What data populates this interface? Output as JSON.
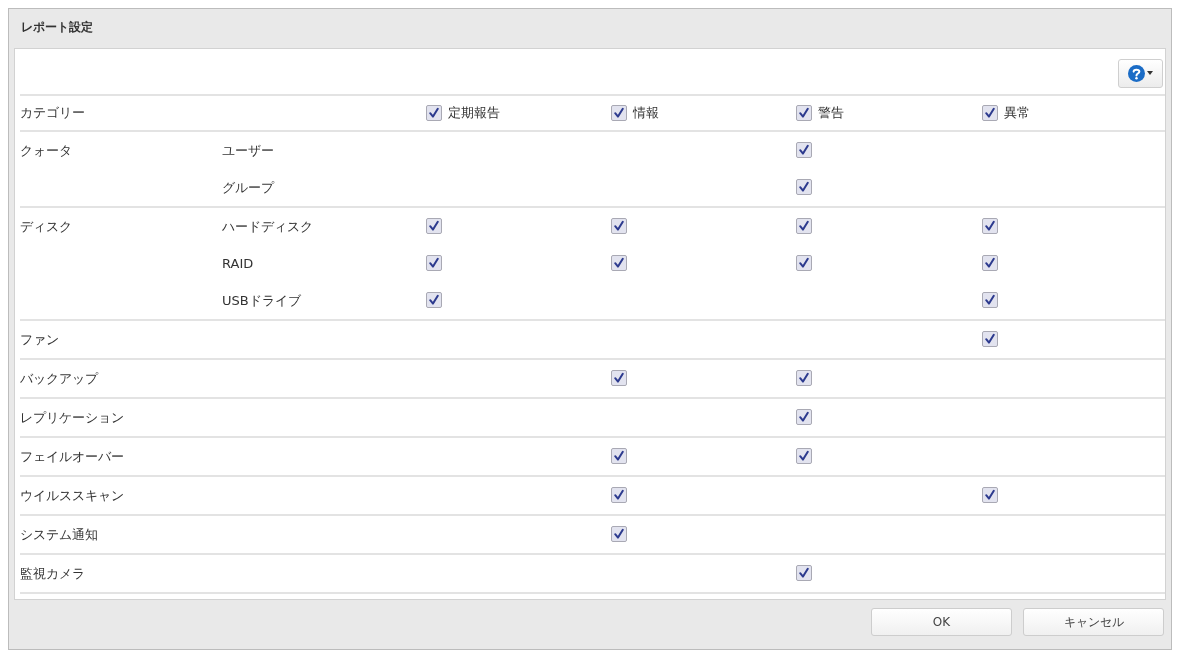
{
  "dialog": {
    "title": "レポート設定"
  },
  "table": {
    "header": {
      "label": "カテゴリー",
      "columns": [
        {
          "label": "定期報告",
          "checked": true
        },
        {
          "label": "情報",
          "checked": true
        },
        {
          "label": "警告",
          "checked": true
        },
        {
          "label": "異常",
          "checked": true
        }
      ]
    },
    "rows": [
      {
        "label": "クォータ",
        "children": [
          {
            "label": "ユーザー",
            "cells": [
              null,
              null,
              {
                "checked": true
              },
              null
            ]
          },
          {
            "label": "グループ",
            "cells": [
              null,
              null,
              {
                "checked": true
              },
              null
            ]
          }
        ]
      },
      {
        "label": "ディスク",
        "children": [
          {
            "label": "ハードディスク",
            "cells": [
              {
                "checked": true
              },
              {
                "checked": true
              },
              {
                "checked": true
              },
              {
                "checked": true
              }
            ]
          },
          {
            "label": "RAID",
            "cells": [
              {
                "checked": true
              },
              {
                "checked": true
              },
              {
                "checked": true
              },
              {
                "checked": true
              }
            ]
          },
          {
            "label": "USBドライブ",
            "cells": [
              {
                "checked": true
              },
              null,
              null,
              {
                "checked": true
              }
            ]
          }
        ]
      },
      {
        "label": "ファン",
        "cells": [
          null,
          null,
          null,
          {
            "checked": true
          }
        ]
      },
      {
        "label": "バックアップ",
        "cells": [
          null,
          {
            "checked": true
          },
          {
            "checked": true
          },
          null
        ]
      },
      {
        "label": "レプリケーション",
        "cells": [
          null,
          null,
          {
            "checked": true
          },
          null
        ]
      },
      {
        "label": "フェイルオーバー",
        "cells": [
          null,
          {
            "checked": true
          },
          {
            "checked": true
          },
          null
        ]
      },
      {
        "label": "ウイルススキャン",
        "cells": [
          null,
          {
            "checked": true
          },
          null,
          {
            "checked": true
          }
        ]
      },
      {
        "label": "システム通知",
        "cells": [
          null,
          {
            "checked": true
          },
          null,
          null
        ]
      },
      {
        "label": "監視カメラ",
        "cells": [
          null,
          null,
          {
            "checked": true
          },
          null
        ]
      }
    ]
  },
  "buttons": [
    "OK",
    "キャンセル"
  ]
}
